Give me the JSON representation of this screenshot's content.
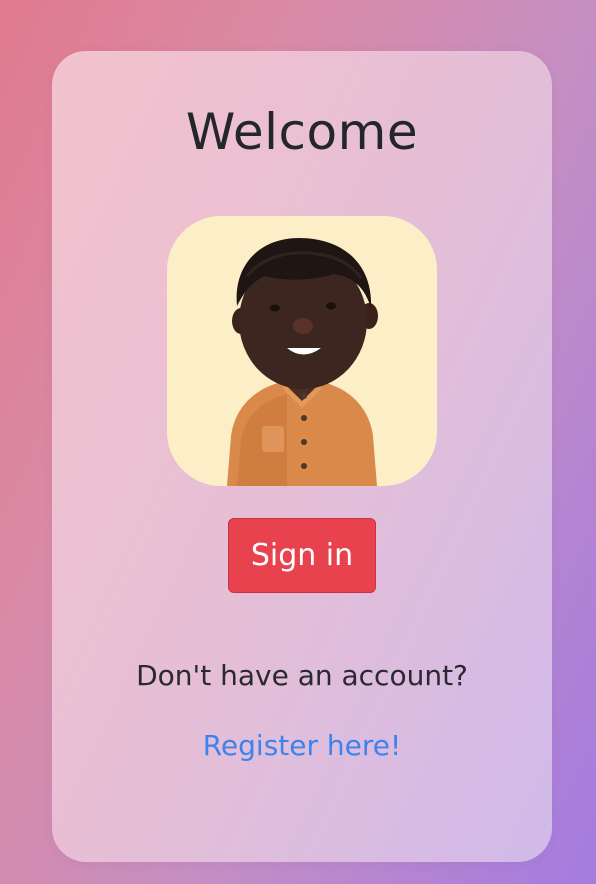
{
  "card": {
    "title": "Welcome",
    "avatar": {
      "icon": "person-avatar-icon",
      "background": "#fcefc8"
    },
    "signin_label": "Sign in",
    "no_account_text": "Don't have an account?",
    "register_link": "Register here!"
  },
  "colors": {
    "signin_button": "#e8424f",
    "link": "#3d83ee",
    "title_text": "#23272b"
  }
}
